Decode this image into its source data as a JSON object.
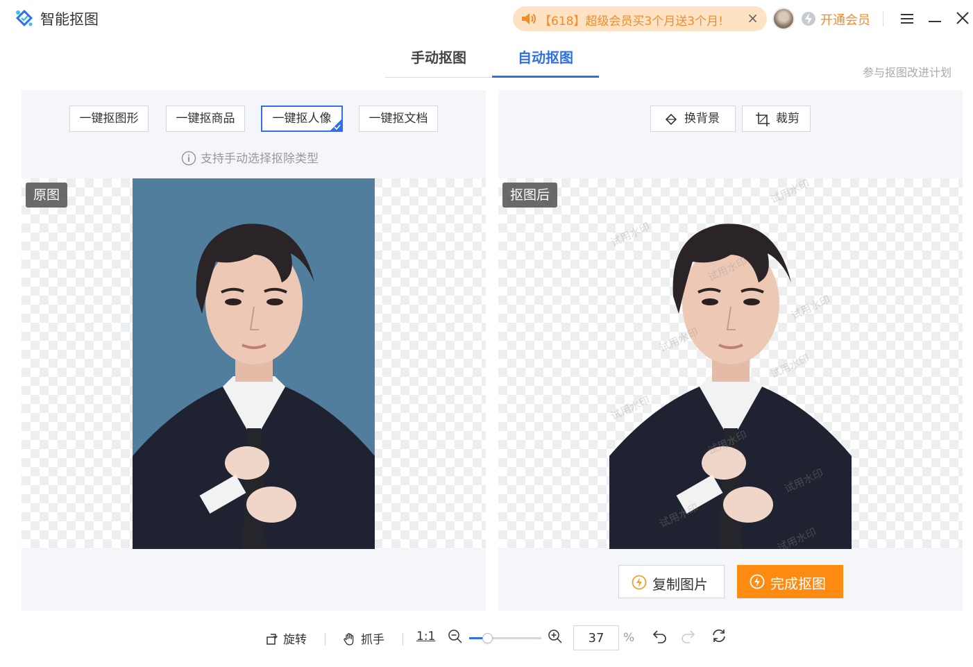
{
  "app": {
    "title": "智能抠图"
  },
  "promo": {
    "text": "【618】超级会员买3个月送3个月!",
    "close": "×"
  },
  "user": {
    "vip_label": "开通会员"
  },
  "tabs": [
    {
      "label": "手动抠图",
      "active": false
    },
    {
      "label": "自动抠图",
      "active": true
    }
  ],
  "join_link": "参与抠图改进计划",
  "left_panel": {
    "options": [
      {
        "label": "一键抠图形",
        "selected": false
      },
      {
        "label": "一键抠商品",
        "selected": false
      },
      {
        "label": "一键抠人像",
        "selected": true
      },
      {
        "label": "一键抠文档",
        "selected": false
      }
    ],
    "hint": "支持手动选择抠除类型",
    "canvas_label": "原图"
  },
  "right_panel": {
    "tools": [
      {
        "label": "换背景",
        "icon": "paint-bucket-icon"
      },
      {
        "label": "裁剪",
        "icon": "crop-icon"
      }
    ],
    "canvas_label": "抠图后",
    "watermark": "试用水印",
    "copy_button": "复制图片",
    "done_button": "完成抠图"
  },
  "bottom": {
    "rotate": "旋转",
    "hand": "抓手",
    "one_to_one": "1:1",
    "zoom_value": "37",
    "zoom_unit": "%",
    "zoom_fraction": 0.25
  },
  "colors": {
    "accent": "#2f6fe8",
    "orange": "#fd8b12",
    "promo_bg": "#fde3c4",
    "photo_bg": "#527e9d"
  }
}
